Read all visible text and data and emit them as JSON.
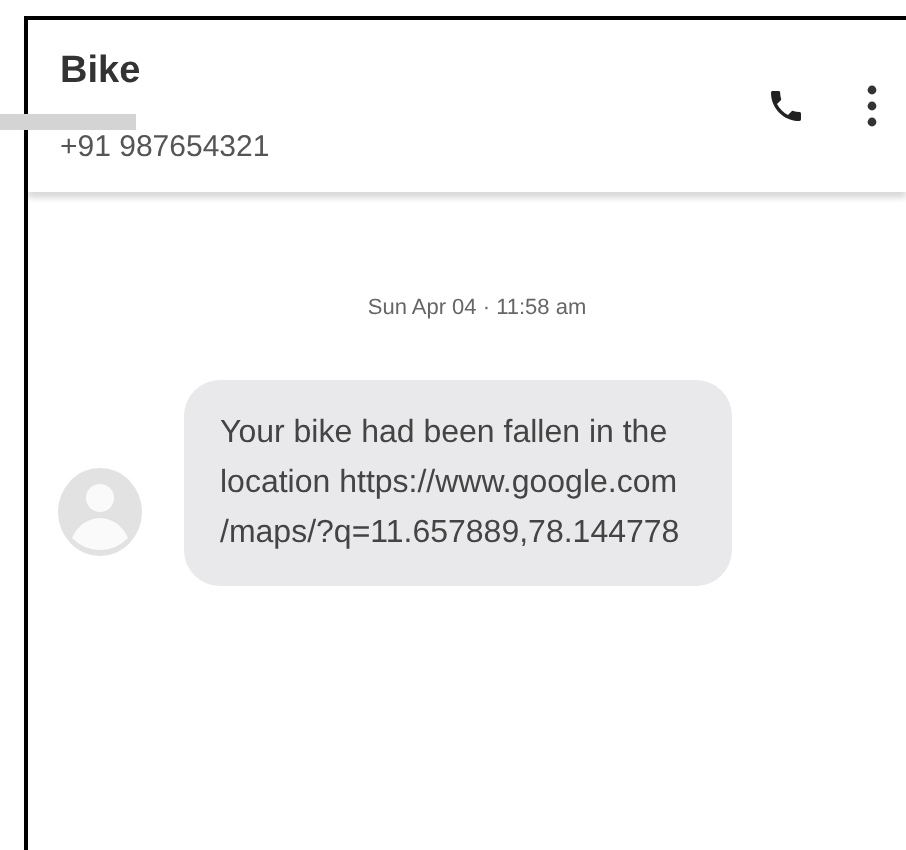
{
  "contact": {
    "name": "Bike",
    "number": "+91 987654321"
  },
  "timestamp": "Sun Apr 04 · 11:58 am",
  "messages": [
    {
      "text": "Your bike had been fallen in the\nlocation https://www.google.com\n/maps/?q=11.657889,78.144778"
    }
  ]
}
